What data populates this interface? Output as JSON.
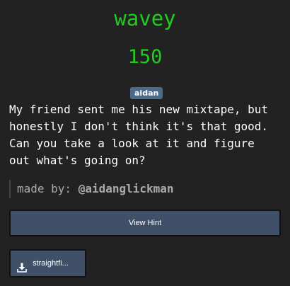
{
  "challenge": {
    "title": "wavey",
    "points": "150",
    "author_tag": "aidan",
    "description": "My friend sent me his new mixtape, but\nhonestly I don't think it's that good.\nCan you take a look at it and figure\nout what's going on?",
    "made_by_label": "made by:",
    "made_by_handle": "@aidanglickman",
    "hint_button_label": "View Hint",
    "file_button_label": "straightfi...",
    "file_icon": "download-icon"
  },
  "colors": {
    "background": "#222222",
    "title_green": "#1fcc1f",
    "badge_blue": "#4e6a8a",
    "button_blue": "#3f5068"
  }
}
